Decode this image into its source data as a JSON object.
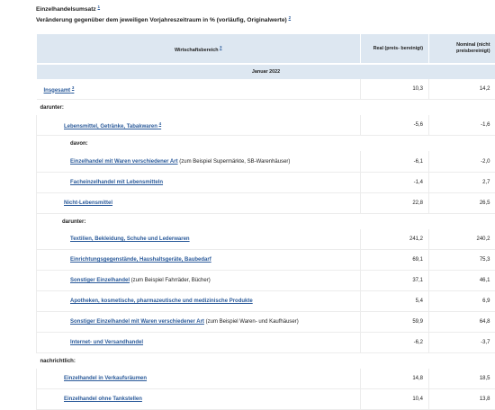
{
  "caption": {
    "line1": "Einzelhandelsumsatz",
    "line1_ref": "1",
    "line2": "Veränderung gegenüber dem jeweiligen Vorjahreszeitraum in % (vorläufig, Originalwerte)",
    "line2_ref": "2"
  },
  "table": {
    "headers": {
      "sector": "Wirtschaftsbereich",
      "sector_ref": "3",
      "real": "Real (preis- bereinigt)",
      "nominal": "Nominal (nicht preisbereinigt)"
    },
    "period": "Januar 2022",
    "rows": [
      {
        "label": "Insgesamt",
        "ref": "3",
        "extra": "",
        "real": "10,3",
        "nominal": "14,2"
      },
      {
        "label": "darunter:"
      },
      {
        "label": "Lebensmittel, Getränke, Tabakwaren",
        "ref": "4",
        "extra": "",
        "real": "-5,6",
        "nominal": "-1,6"
      },
      {
        "label": "davon:"
      },
      {
        "label": "Einzelhandel mit Waren verschiedener Art",
        "ref": "",
        "extra": " (zum Beispiel Supermärkte, SB-Warenhäuser)",
        "real": "-6,1",
        "nominal": "-2,0"
      },
      {
        "label": "Facheinzelhandel mit Lebensmitteln",
        "ref": "",
        "extra": "",
        "real": "-1,4",
        "nominal": "2,7"
      },
      {
        "label": "Nicht-Lebensmittel",
        "ref": "",
        "extra": "",
        "real": "22,8",
        "nominal": "26,5"
      },
      {
        "label": "darunter:"
      },
      {
        "label": "Textilien, Bekleidung, Schuhe und Lederwaren",
        "ref": "",
        "extra": "",
        "real": "241,2",
        "nominal": "240,2"
      },
      {
        "label": "Einrichtungsgegenstände, Haushaltsgeräte, Baubedarf",
        "ref": "",
        "extra": "",
        "real": "69,1",
        "nominal": "75,3"
      },
      {
        "label": "Sonstiger Einzelhandel",
        "ref": "",
        "extra": " (zum Beispiel Fahrräder, Bücher)",
        "real": "37,1",
        "nominal": "46,1"
      },
      {
        "label": "Apotheken, kosmetische, pharmazeutische und medizinische Produkte",
        "ref": "",
        "extra": "",
        "real": "5,4",
        "nominal": "6,9"
      },
      {
        "label": "Sonstiger Einzelhandel mit Waren verschiedener Art",
        "ref": "",
        "extra": " (zum Beispiel Waren- und Kaufhäuser)",
        "real": "59,9",
        "nominal": "64,8"
      },
      {
        "label": "Internet- und Versandhandel",
        "ref": "",
        "extra": "",
        "real": "-6,2",
        "nominal": "-3,7"
      },
      {
        "label": "nachrichtlich:"
      },
      {
        "label": "Einzelhandel in Verkaufsräumen",
        "ref": "",
        "extra": "",
        "real": "14,8",
        "nominal": "18,5"
      },
      {
        "label": "Einzelhandel ohne Tankstellen",
        "ref": "",
        "extra": "",
        "real": "10,4",
        "nominal": "13,8"
      }
    ]
  }
}
